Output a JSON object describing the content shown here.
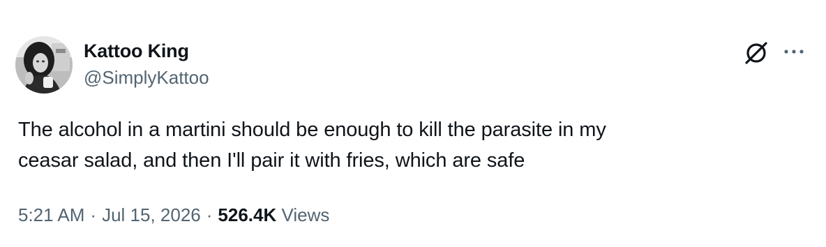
{
  "author": {
    "display_name": "Kattoo King",
    "handle": "@SimplyKattoo"
  },
  "icons": {
    "avatar": "profile-photo",
    "grok": "grok-icon",
    "more": "more-icon"
  },
  "tweet": {
    "text_line_1": "The alcohol in a martini should be enough to kill the parasite in my",
    "text_line_2": "ceasar salad, and then I'll pair it with fries, which are safe"
  },
  "meta": {
    "time": "5:21 AM",
    "separator": "·",
    "date": "Jul 15, 2026",
    "views_count": "526.4K",
    "views_label": "Views"
  },
  "colors": {
    "text_primary": "#0f1419",
    "text_secondary": "#536471",
    "background": "#ffffff"
  }
}
